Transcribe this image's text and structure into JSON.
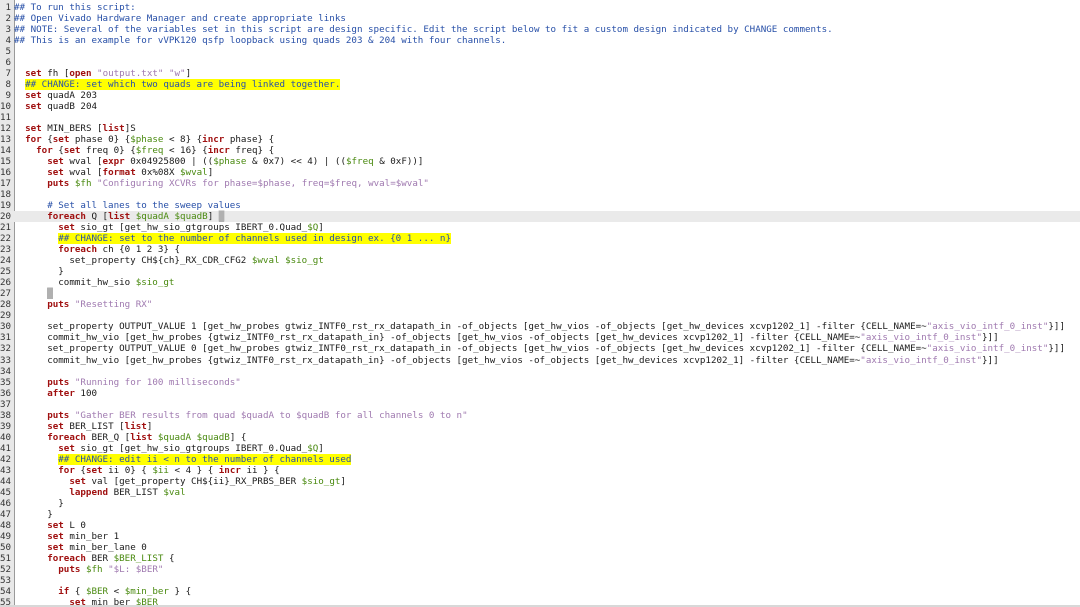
{
  "editor": {
    "lines": [
      {
        "n": "1",
        "t": [
          {
            "c": "cmt",
            "s": "## To run this script:"
          }
        ]
      },
      {
        "n": "2",
        "t": [
          {
            "c": "cmt",
            "s": "## Open Vivado Hardware Manager and create appropriate links"
          }
        ]
      },
      {
        "n": "3",
        "t": [
          {
            "c": "cmt",
            "s": "## NOTE: Several of the variables set in this script are design specific. Edit the script below to fit a custom design indicated by CHANGE comments."
          }
        ]
      },
      {
        "n": "4",
        "t": [
          {
            "c": "cmt",
            "s": "## This is an example for vVPK120 qsfp loopback using quads 203 & 204 with four channels."
          }
        ]
      },
      {
        "n": "5",
        "t": []
      },
      {
        "n": "6",
        "t": []
      },
      {
        "n": "7",
        "t": [
          {
            "c": "code",
            "s": "  "
          },
          {
            "c": "kw",
            "s": "set"
          },
          {
            "c": "code",
            "s": " fh ["
          },
          {
            "c": "kw",
            "s": "open"
          },
          {
            "c": "code",
            "s": " "
          },
          {
            "c": "str",
            "s": "\"output.txt\""
          },
          {
            "c": "code",
            "s": " "
          },
          {
            "c": "str",
            "s": "\"w\""
          },
          {
            "c": "code",
            "s": "]"
          }
        ]
      },
      {
        "n": "8",
        "t": [
          {
            "c": "code",
            "s": "  "
          },
          {
            "c": "cmt hl",
            "s": "## CHANGE: set which two quads are being linked together."
          }
        ]
      },
      {
        "n": "9",
        "t": [
          {
            "c": "code",
            "s": "  "
          },
          {
            "c": "kw",
            "s": "set"
          },
          {
            "c": "code",
            "s": " quadA 203"
          }
        ]
      },
      {
        "n": "10",
        "t": [
          {
            "c": "code",
            "s": "  "
          },
          {
            "c": "kw",
            "s": "set"
          },
          {
            "c": "code",
            "s": " quadB 204"
          }
        ]
      },
      {
        "n": "11",
        "t": []
      },
      {
        "n": "12",
        "t": [
          {
            "c": "code",
            "s": "  "
          },
          {
            "c": "kw",
            "s": "set"
          },
          {
            "c": "code",
            "s": " MIN_BERS ["
          },
          {
            "c": "kw",
            "s": "list"
          },
          {
            "c": "code",
            "s": "]S"
          }
        ]
      },
      {
        "n": "13",
        "t": [
          {
            "c": "code",
            "s": "  "
          },
          {
            "c": "kw",
            "s": "for"
          },
          {
            "c": "code",
            "s": " {"
          },
          {
            "c": "kw",
            "s": "set"
          },
          {
            "c": "code",
            "s": " phase 0} {"
          },
          {
            "c": "var",
            "s": "$phase"
          },
          {
            "c": "code",
            "s": " < 8} {"
          },
          {
            "c": "kw",
            "s": "incr"
          },
          {
            "c": "code",
            "s": " phase} {"
          }
        ]
      },
      {
        "n": "14",
        "t": [
          {
            "c": "code",
            "s": "    "
          },
          {
            "c": "kw",
            "s": "for"
          },
          {
            "c": "code",
            "s": " {"
          },
          {
            "c": "kw",
            "s": "set"
          },
          {
            "c": "code",
            "s": " freq 0} {"
          },
          {
            "c": "var",
            "s": "$freq"
          },
          {
            "c": "code",
            "s": " < 16} {"
          },
          {
            "c": "kw",
            "s": "incr"
          },
          {
            "c": "code",
            "s": " freq} {"
          }
        ]
      },
      {
        "n": "15",
        "t": [
          {
            "c": "code",
            "s": "      "
          },
          {
            "c": "kw",
            "s": "set"
          },
          {
            "c": "code",
            "s": " wval ["
          },
          {
            "c": "kw",
            "s": "expr"
          },
          {
            "c": "code",
            "s": " 0x04925800 | (("
          },
          {
            "c": "var",
            "s": "$phase"
          },
          {
            "c": "code",
            "s": " & 0x7) << 4) | (("
          },
          {
            "c": "var",
            "s": "$freq"
          },
          {
            "c": "code",
            "s": " & 0xF))]"
          }
        ]
      },
      {
        "n": "16",
        "t": [
          {
            "c": "code",
            "s": "      "
          },
          {
            "c": "kw",
            "s": "set"
          },
          {
            "c": "code",
            "s": " wval ["
          },
          {
            "c": "kw",
            "s": "format"
          },
          {
            "c": "code",
            "s": " 0x%08X "
          },
          {
            "c": "var",
            "s": "$wval"
          },
          {
            "c": "code",
            "s": "]"
          }
        ]
      },
      {
        "n": "17",
        "t": [
          {
            "c": "code",
            "s": "      "
          },
          {
            "c": "kw",
            "s": "puts"
          },
          {
            "c": "code",
            "s": " "
          },
          {
            "c": "var",
            "s": "$fh"
          },
          {
            "c": "code",
            "s": " "
          },
          {
            "c": "str",
            "s": "\"Configuring XCVRs for phase=$phase, freq=$freq, wval=$wval\""
          }
        ]
      },
      {
        "n": "18",
        "t": []
      },
      {
        "n": "19",
        "t": [
          {
            "c": "code",
            "s": "      "
          },
          {
            "c": "cmt",
            "s": "# Set all lanes to the sweep values"
          }
        ]
      },
      {
        "n": "20",
        "cur": true,
        "t": [
          {
            "c": "code",
            "s": "      "
          },
          {
            "c": "kw",
            "s": "foreach"
          },
          {
            "c": "code",
            "s": " Q ["
          },
          {
            "c": "kw",
            "s": "list"
          },
          {
            "c": "code",
            "s": " "
          },
          {
            "c": "var",
            "s": "$quadA"
          },
          {
            "c": "code",
            "s": " "
          },
          {
            "c": "var",
            "s": "$quadB"
          },
          {
            "c": "code",
            "s": "] "
          },
          {
            "c": "cursor-block",
            "s": "█"
          }
        ]
      },
      {
        "n": "21",
        "t": [
          {
            "c": "code",
            "s": "        "
          },
          {
            "c": "kw",
            "s": "set"
          },
          {
            "c": "code",
            "s": " sio_gt [get_hw_sio_gtgroups IBERT_0.Quad_"
          },
          {
            "c": "var",
            "s": "$Q"
          },
          {
            "c": "code",
            "s": "]"
          }
        ]
      },
      {
        "n": "22",
        "t": [
          {
            "c": "code",
            "s": "        "
          },
          {
            "c": "cmt hl",
            "s": "## CHANGE: set to the number of channels used in design ex. {0 1 ... n}"
          }
        ]
      },
      {
        "n": "23",
        "t": [
          {
            "c": "code",
            "s": "        "
          },
          {
            "c": "kw",
            "s": "foreach"
          },
          {
            "c": "code",
            "s": " ch {0 1 2 3} {"
          }
        ]
      },
      {
        "n": "24",
        "t": [
          {
            "c": "code",
            "s": "          set_property CH${ch}_RX_CDR_CFG2 "
          },
          {
            "c": "var",
            "s": "$wval"
          },
          {
            "c": "code",
            "s": " "
          },
          {
            "c": "var",
            "s": "$sio_gt"
          }
        ]
      },
      {
        "n": "25",
        "t": [
          {
            "c": "code",
            "s": "        }"
          }
        ]
      },
      {
        "n": "26",
        "t": [
          {
            "c": "code",
            "s": "        commit_hw_sio "
          },
          {
            "c": "var",
            "s": "$sio_gt"
          }
        ]
      },
      {
        "n": "27",
        "t": [
          {
            "c": "code",
            "s": "      "
          },
          {
            "c": "cursor-block",
            "s": "█"
          }
        ]
      },
      {
        "n": "28",
        "t": [
          {
            "c": "code",
            "s": "      "
          },
          {
            "c": "kw",
            "s": "puts"
          },
          {
            "c": "code",
            "s": " "
          },
          {
            "c": "str",
            "s": "\"Resetting RX\""
          }
        ]
      },
      {
        "n": "29",
        "t": []
      },
      {
        "n": "30",
        "t": [
          {
            "c": "code",
            "s": "      set_property OUTPUT_VALUE 1 [get_hw_probes gtwiz_INTF0_rst_rx_datapath_in -of_objects [get_hw_vios -of_objects [get_hw_devices xcvp1202_1] -filter {CELL_NAME=~"
          },
          {
            "c": "str",
            "s": "\"axis_vio_intf_0_inst\""
          },
          {
            "c": "code",
            "s": "}]]"
          }
        ]
      },
      {
        "n": "31",
        "t": [
          {
            "c": "code",
            "s": "      commit_hw_vio [get_hw_probes {gtwiz_INTF0_rst_rx_datapath_in} -of_objects [get_hw_vios -of_objects [get_hw_devices xcvp1202_1] -filter {CELL_NAME=~"
          },
          {
            "c": "str",
            "s": "\"axis_vio_intf_0_inst\""
          },
          {
            "c": "code",
            "s": "}]]"
          }
        ]
      },
      {
        "n": "32",
        "t": [
          {
            "c": "code",
            "s": "      set_property OUTPUT_VALUE 0 [get_hw_probes gtwiz_INTF0_rst_rx_datapath_in -of_objects [get_hw_vios -of_objects [get_hw_devices xcvp1202_1] -filter {CELL_NAME=~"
          },
          {
            "c": "str",
            "s": "\"axis_vio_intf_0_inst\""
          },
          {
            "c": "code",
            "s": "}]]"
          }
        ]
      },
      {
        "n": "33",
        "t": [
          {
            "c": "code",
            "s": "      commit_hw_vio [get_hw_probes {gtwiz_INTF0_rst_rx_datapath_in} -of_objects [get_hw_vios -of_objects [get_hw_devices xcvp1202_1] -filter {CELL_NAME=~"
          },
          {
            "c": "str",
            "s": "\"axis_vio_intf_0_inst\""
          },
          {
            "c": "code",
            "s": "}]]"
          }
        ]
      },
      {
        "n": "34",
        "t": []
      },
      {
        "n": "35",
        "t": [
          {
            "c": "code",
            "s": "      "
          },
          {
            "c": "kw",
            "s": "puts"
          },
          {
            "c": "code",
            "s": " "
          },
          {
            "c": "str",
            "s": "\"Running for 100 milliseconds\""
          }
        ]
      },
      {
        "n": "36",
        "t": [
          {
            "c": "code",
            "s": "      "
          },
          {
            "c": "kw",
            "s": "after"
          },
          {
            "c": "code",
            "s": " 100"
          }
        ]
      },
      {
        "n": "37",
        "t": []
      },
      {
        "n": "38",
        "t": [
          {
            "c": "code",
            "s": "      "
          },
          {
            "c": "kw",
            "s": "puts"
          },
          {
            "c": "code",
            "s": " "
          },
          {
            "c": "str",
            "s": "\"Gather BER results from quad $quadA to $quadB for all channels 0 to n\""
          }
        ]
      },
      {
        "n": "39",
        "t": [
          {
            "c": "code",
            "s": "      "
          },
          {
            "c": "kw",
            "s": "set"
          },
          {
            "c": "code",
            "s": " BER_LIST ["
          },
          {
            "c": "kw",
            "s": "list"
          },
          {
            "c": "code",
            "s": "]"
          }
        ]
      },
      {
        "n": "40",
        "t": [
          {
            "c": "code",
            "s": "      "
          },
          {
            "c": "kw",
            "s": "foreach"
          },
          {
            "c": "code",
            "s": " BER_Q ["
          },
          {
            "c": "kw",
            "s": "list"
          },
          {
            "c": "code",
            "s": " "
          },
          {
            "c": "var",
            "s": "$quadA"
          },
          {
            "c": "code",
            "s": " "
          },
          {
            "c": "var",
            "s": "$quadB"
          },
          {
            "c": "code",
            "s": "] {"
          }
        ]
      },
      {
        "n": "41",
        "t": [
          {
            "c": "code",
            "s": "        "
          },
          {
            "c": "kw",
            "s": "set"
          },
          {
            "c": "code",
            "s": " sio_gt [get_hw_sio_gtgroups IBERT_0.Quad_"
          },
          {
            "c": "var",
            "s": "$Q"
          },
          {
            "c": "code",
            "s": "]"
          }
        ]
      },
      {
        "n": "42",
        "t": [
          {
            "c": "code",
            "s": "        "
          },
          {
            "c": "cmt hl",
            "s": "## CHANGE: edit ii < n to the number of channels used"
          }
        ]
      },
      {
        "n": "43",
        "t": [
          {
            "c": "code",
            "s": "        "
          },
          {
            "c": "kw",
            "s": "for"
          },
          {
            "c": "code",
            "s": " {"
          },
          {
            "c": "kw",
            "s": "set"
          },
          {
            "c": "code",
            "s": " ii 0} { "
          },
          {
            "c": "var",
            "s": "$ii"
          },
          {
            "c": "code",
            "s": " < 4 } { "
          },
          {
            "c": "kw",
            "s": "incr"
          },
          {
            "c": "code",
            "s": " ii } {"
          }
        ]
      },
      {
        "n": "44",
        "t": [
          {
            "c": "code",
            "s": "          "
          },
          {
            "c": "kw",
            "s": "set"
          },
          {
            "c": "code",
            "s": " val [get_property CH${ii}_RX_PRBS_BER "
          },
          {
            "c": "var",
            "s": "$sio_gt"
          },
          {
            "c": "code",
            "s": "]"
          }
        ]
      },
      {
        "n": "45",
        "t": [
          {
            "c": "code",
            "s": "          "
          },
          {
            "c": "kw",
            "s": "lappend"
          },
          {
            "c": "code",
            "s": " BER_LIST "
          },
          {
            "c": "var",
            "s": "$val"
          }
        ]
      },
      {
        "n": "46",
        "t": [
          {
            "c": "code",
            "s": "        }"
          }
        ]
      },
      {
        "n": "47",
        "t": [
          {
            "c": "code",
            "s": "      }"
          }
        ]
      },
      {
        "n": "48",
        "t": [
          {
            "c": "code",
            "s": "      "
          },
          {
            "c": "kw",
            "s": "set"
          },
          {
            "c": "code",
            "s": " L 0"
          }
        ]
      },
      {
        "n": "49",
        "t": [
          {
            "c": "code",
            "s": "      "
          },
          {
            "c": "kw",
            "s": "set"
          },
          {
            "c": "code",
            "s": " min_ber 1"
          }
        ]
      },
      {
        "n": "50",
        "t": [
          {
            "c": "code",
            "s": "      "
          },
          {
            "c": "kw",
            "s": "set"
          },
          {
            "c": "code",
            "s": " min_ber_lane 0"
          }
        ]
      },
      {
        "n": "51",
        "t": [
          {
            "c": "code",
            "s": "      "
          },
          {
            "c": "kw",
            "s": "foreach"
          },
          {
            "c": "code",
            "s": " BER "
          },
          {
            "c": "var",
            "s": "$BER_LIST"
          },
          {
            "c": "code",
            "s": " {"
          }
        ]
      },
      {
        "n": "52",
        "t": [
          {
            "c": "code",
            "s": "        "
          },
          {
            "c": "kw",
            "s": "puts"
          },
          {
            "c": "code",
            "s": " "
          },
          {
            "c": "var",
            "s": "$fh"
          },
          {
            "c": "code",
            "s": " "
          },
          {
            "c": "str",
            "s": "\"$L: $BER\""
          }
        ]
      },
      {
        "n": "53",
        "t": []
      },
      {
        "n": "54",
        "t": [
          {
            "c": "code",
            "s": "        "
          },
          {
            "c": "kw",
            "s": "if"
          },
          {
            "c": "code",
            "s": " { "
          },
          {
            "c": "var",
            "s": "$BER"
          },
          {
            "c": "code",
            "s": " < "
          },
          {
            "c": "var",
            "s": "$min_ber"
          },
          {
            "c": "code",
            "s": " } {"
          }
        ]
      },
      {
        "n": "55",
        "t": [
          {
            "c": "code",
            "s": "          "
          },
          {
            "c": "kw",
            "s": "set"
          },
          {
            "c": "code",
            "s": " min_ber "
          },
          {
            "c": "var",
            "s": "$BER"
          }
        ]
      }
    ]
  }
}
